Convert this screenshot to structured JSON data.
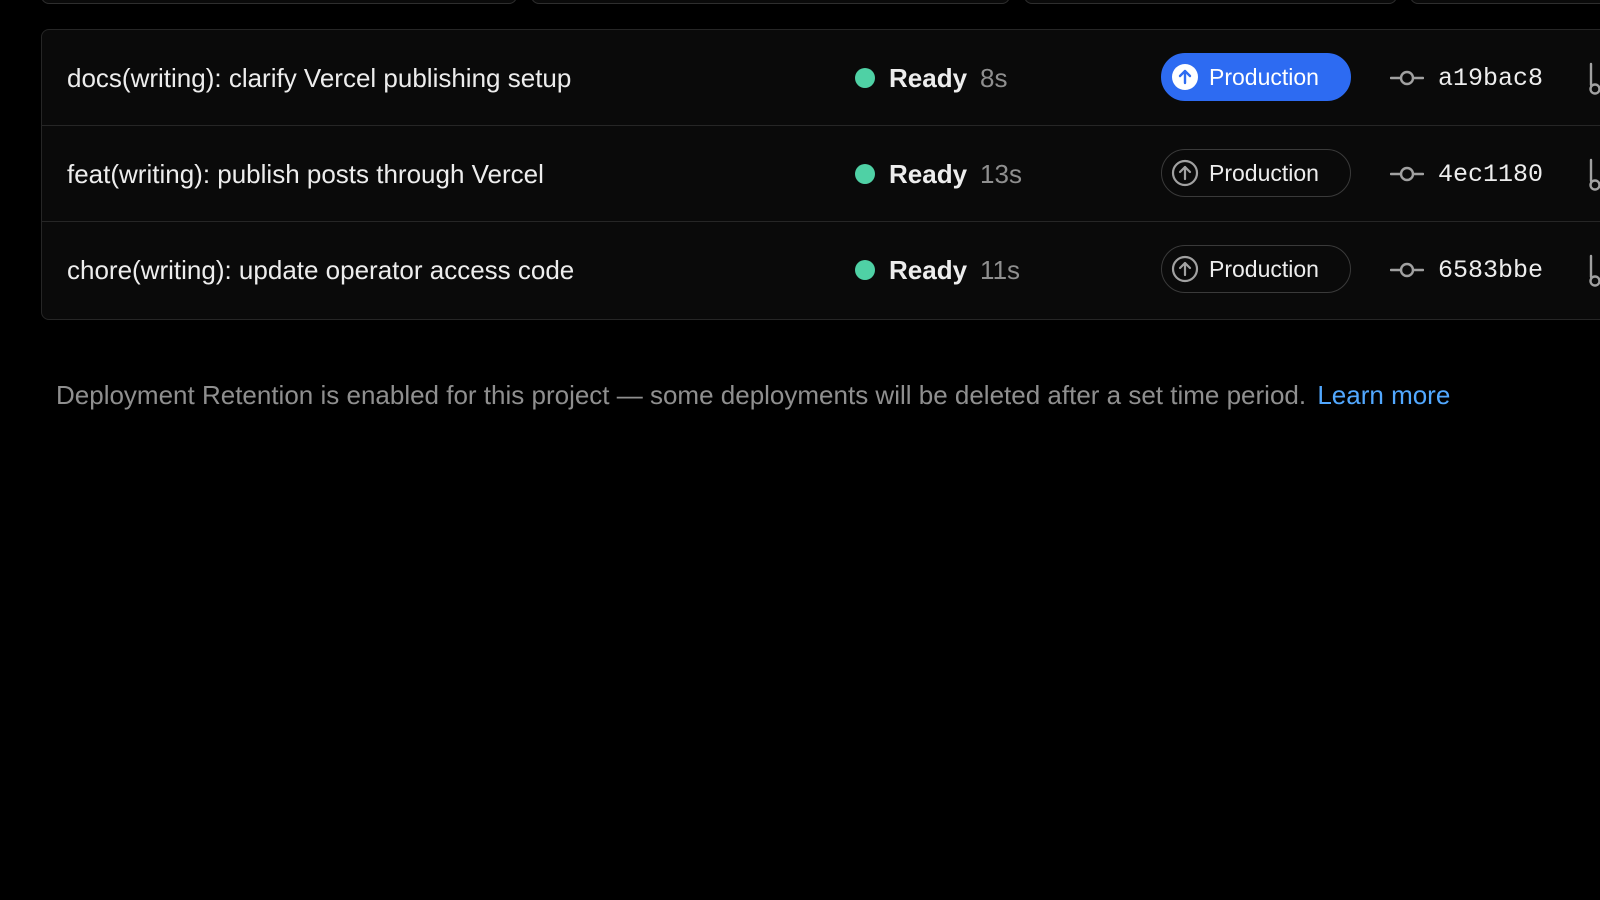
{
  "deployments": [
    {
      "message": "docs(writing): clarify Vercel publishing setup",
      "status": "Ready",
      "duration": "8s",
      "environment": "Production",
      "environment_active": true,
      "commit": "a19bac8"
    },
    {
      "message": "feat(writing): publish posts through Vercel",
      "status": "Ready",
      "duration": "13s",
      "environment": "Production",
      "environment_active": false,
      "commit": "4ec1180"
    },
    {
      "message": "chore(writing): update operator access code",
      "status": "Ready",
      "duration": "11s",
      "environment": "Production",
      "environment_active": false,
      "commit": "6583bbe"
    }
  ],
  "retention": {
    "notice": "Deployment Retention is enabled for this project — some deployments will be deleted after a set time period.",
    "link_label": "Learn more"
  },
  "colors": {
    "background": "#000000",
    "status_ready": "#4fd1a5",
    "accent": "#2d6bf2",
    "link": "#52a8ff"
  },
  "icons": {
    "environment": "arrow-up-circle-icon",
    "commit": "git-commit-icon",
    "branch": "git-branch-icon"
  }
}
